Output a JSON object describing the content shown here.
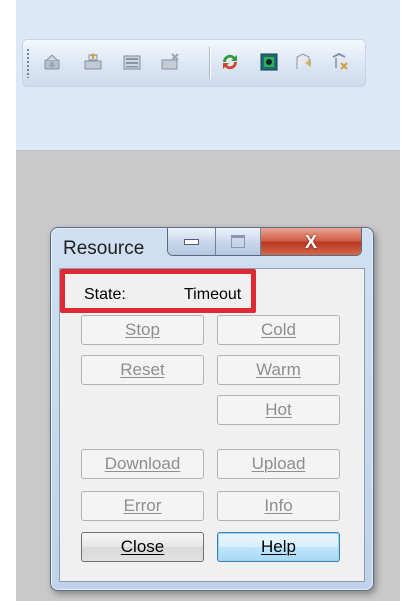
{
  "toolbar": {
    "buttons": [
      {
        "name": "toolbar-button-1",
        "icon": "load-icon"
      },
      {
        "name": "toolbar-button-2",
        "icon": "module-upload-icon"
      },
      {
        "name": "toolbar-button-3",
        "icon": "module-list-icon"
      },
      {
        "name": "toolbar-button-4",
        "icon": "remove-module-icon"
      },
      {
        "name": "toolbar-button-5",
        "icon": "refresh-icon"
      },
      {
        "name": "toolbar-button-6",
        "icon": "resource-icon"
      },
      {
        "name": "toolbar-button-7",
        "icon": "connect-icon"
      },
      {
        "name": "toolbar-button-8",
        "icon": "disconnect-icon"
      }
    ]
  },
  "dialog": {
    "title": "Resource",
    "close_glyph": "X",
    "state_label": "State:",
    "state_value": "Timeout",
    "highlight_color": "#e02a33",
    "buttons": {
      "stop": "Stop",
      "cold": "Cold",
      "reset": "Reset",
      "warm": "Warm",
      "hot": "Hot",
      "download": "Download",
      "upload": "Upload",
      "error": "Error",
      "info": "Info",
      "close": "Close",
      "help": "Help"
    }
  }
}
